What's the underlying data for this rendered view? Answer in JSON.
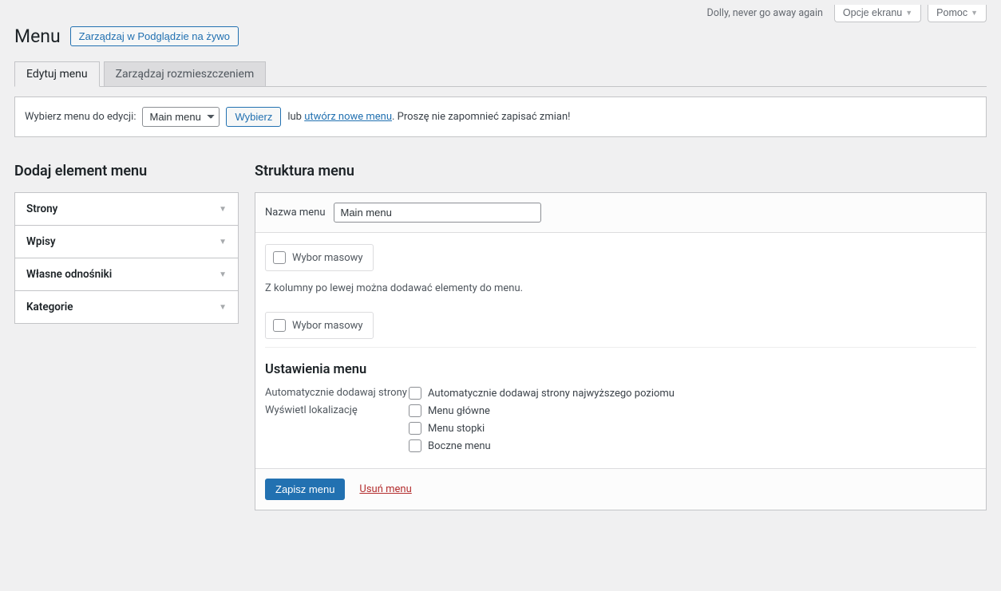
{
  "topbar": {
    "dolly": "Dolly, never go away again",
    "screen_options": "Opcje ekranu",
    "help": "Pomoc"
  },
  "header": {
    "title": "Menu",
    "manage_live": "Zarządzaj w Podglądzie na żywo"
  },
  "tabs": {
    "edit": "Edytuj menu",
    "locations": "Zarządzaj rozmieszczeniem"
  },
  "selectbar": {
    "prompt": "Wybierz menu do edycji:",
    "selected": "Main menu",
    "choose_btn": "Wybierz",
    "or": "lub",
    "create_link": "utwórz nowe menu",
    "reminder": ". Proszę nie zapomnieć zapisać zmian!"
  },
  "left": {
    "heading": "Dodaj element menu",
    "items": [
      "Strony",
      "Wpisy",
      "Własne odnośniki",
      "Kategorie"
    ]
  },
  "right": {
    "heading": "Struktura menu",
    "name_label": "Nazwa menu",
    "name_value": "Main menu",
    "mass_select": "Wybor masowy",
    "empty_hint": "Z kolumny po lewej można dodawać elementy do menu.",
    "settings_heading": "Ustawienia menu",
    "auto_add_label": "Automatycznie dodawaj strony",
    "auto_add_opt": "Automatycznie dodawaj strony najwyższego poziomu",
    "display_label": "Wyświetl lokalizację",
    "locations": [
      "Menu główne",
      "Menu stopki",
      "Boczne menu"
    ],
    "save_btn": "Zapisz menu",
    "delete_link": "Usuń menu"
  }
}
